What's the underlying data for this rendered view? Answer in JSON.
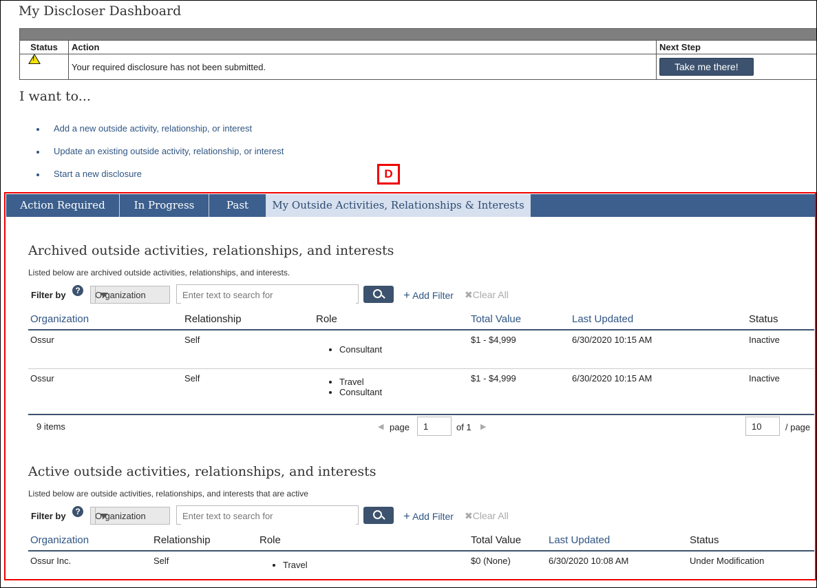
{
  "page_title": "My Discloser Dashboard",
  "status_table": {
    "headers": {
      "status": "Status",
      "action": "Action",
      "next_step": "Next Step"
    },
    "row": {
      "action": "Your required disclosure has not been submitted.",
      "button": "Take me there!",
      "status_icon": "warning-icon"
    }
  },
  "i_want": {
    "heading": "I want to...",
    "links": [
      "Add a new outside activity, relationship, or interest",
      "Update an existing outside activity, relationship, or interest",
      "Start a new disclosure"
    ]
  },
  "marker_label": "D",
  "tabs": [
    "Action Required",
    "In Progress",
    "Past",
    "My Outside Activities, Relationships & Interests"
  ],
  "archived": {
    "title": "Archived outside activities, relationships, and interests",
    "subtitle": "Listed below are archived outside activities, relationships, and interests.",
    "filter": {
      "label": "Filter by",
      "select": "Organization",
      "placeholder": "Enter text to search for",
      "add_filter": "Add Filter",
      "clear_all": "Clear All"
    },
    "columns": [
      "Organization",
      "Relationship",
      "Role",
      "Total Value",
      "Last Updated",
      "Status"
    ],
    "rows": [
      {
        "organization": "Ossur",
        "relationship": "Self",
        "roles": [
          "Consultant"
        ],
        "total_value": "$1 - $4,999",
        "last_updated": "6/30/2020 10:15 AM",
        "status": "Inactive"
      },
      {
        "organization": "Ossur",
        "relationship": "Self",
        "roles": [
          "Travel",
          "Consultant"
        ],
        "total_value": "$1 - $4,999",
        "last_updated": "6/30/2020 10:15 AM",
        "status": "Inactive"
      }
    ],
    "pager": {
      "items": "9 items",
      "page_label": "page",
      "page": "1",
      "of_label": "of 1",
      "per_page": "10",
      "per_page_label": "/ page"
    }
  },
  "active": {
    "title": "Active outside activities, relationships, and interests",
    "subtitle": "Listed below are outside activities, relationships, and interests that are active",
    "filter": {
      "label": "Filter by",
      "select": "Organization",
      "placeholder": "Enter text to search for",
      "add_filter": "Add Filter",
      "clear_all": "Clear All"
    },
    "columns": [
      "Organization",
      "Relationship",
      "Role",
      "Total Value",
      "Last Updated",
      "Status"
    ],
    "rows": [
      {
        "organization": "Ossur Inc.",
        "relationship": "Self",
        "roles": [
          "Travel"
        ],
        "total_value": "$0 (None)",
        "last_updated": "6/30/2020 10:08 AM",
        "status": "Under Modification"
      }
    ]
  }
}
